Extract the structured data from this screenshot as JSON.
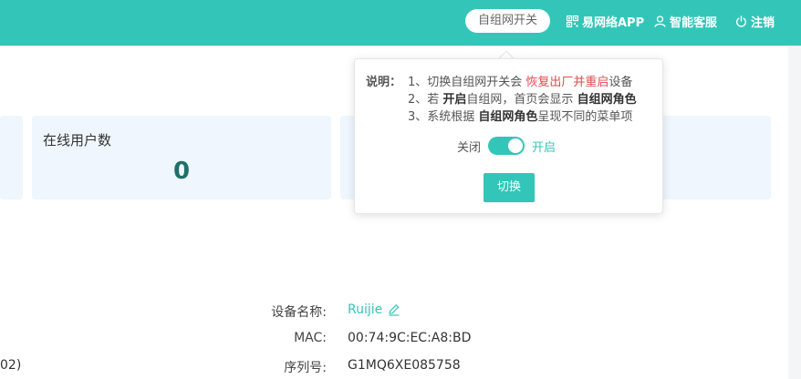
{
  "header": {
    "mesh_switch_button": "自组网开关",
    "app_link": "易网络APP",
    "service_link": "智能客服",
    "logout_link": "注销",
    "icons": {
      "app": "qr-code-icon",
      "service": "user-icon",
      "logout": "power-icon"
    }
  },
  "cards": [
    {
      "title": "在线用户数",
      "value": "0"
    }
  ],
  "popover": {
    "note_label": "说明：",
    "line1_prefix": "1、切换自组网开关会 ",
    "line1_highlight": "恢复出厂并重启",
    "line1_suffix": "设备",
    "line2_prefix": "2、若 ",
    "line2_bold": "开启",
    "line2_middle": "自组网，首页会显示 ",
    "line2_bold2": "自组网角色",
    "line3_prefix": "3、系统根据 ",
    "line3_bold": "自组网角色",
    "line3_suffix": "呈现不同的菜单项",
    "toggle_off_label": "关闭",
    "toggle_on_label": "开启",
    "toggle_state": "on",
    "submit_button": "切换"
  },
  "device_info": {
    "name_label": "设备名称:",
    "name_value": "Ruijie",
    "mac_label": "MAC:",
    "mac_value": "00:74:9C:EC:A8:BD",
    "serial_label": "序列号:",
    "serial_value": "G1MQ6XE085758",
    "left_fragment": "02)"
  },
  "colors": {
    "accent": "#33c6b8",
    "highlight": "#e5484d",
    "card_bg": "#eff6fd",
    "value_color": "#1f6f6a"
  }
}
